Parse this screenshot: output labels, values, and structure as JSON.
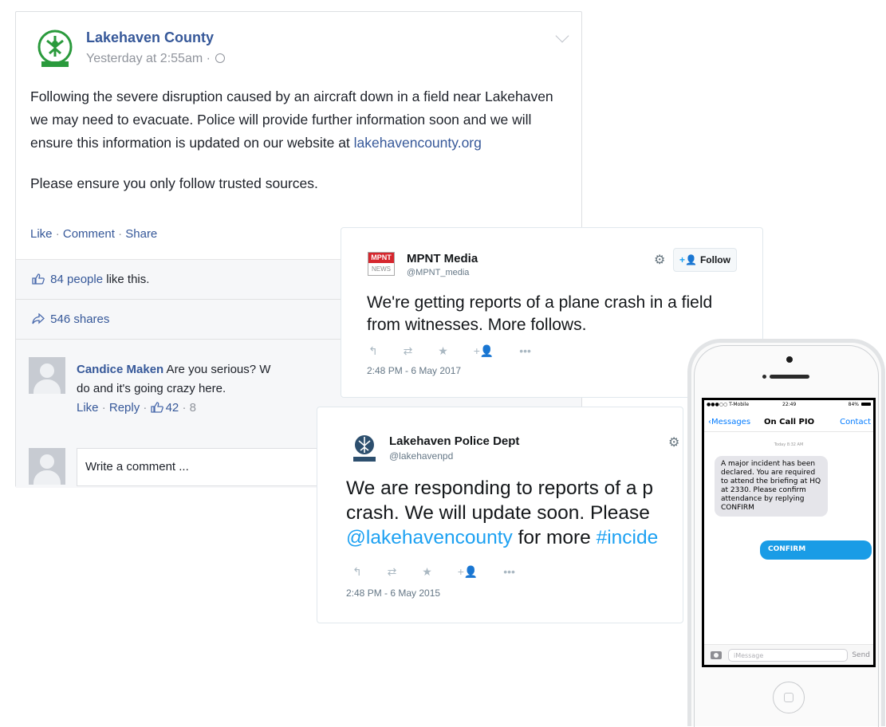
{
  "facebook": {
    "page_name": "Lakehaven County",
    "time": "Yesterday at 2:55am ·",
    "body_line1_pre": "Following the severe disruption caused by an aircraft down in a field near Lakehaven we may need to evacuate. Police will provide further information soon and we will ensure this information is updated on our website at ",
    "body_link": "lakehavencounty.org",
    "body_line2": "Please ensure you only follow trusted sources.",
    "actions": {
      "like": "Like",
      "comment": "Comment",
      "share": "Share",
      "separator": "·"
    },
    "likes_count": "84 people",
    "likes_suffix": " like this.",
    "shares": "546 shares",
    "comment": {
      "author": "Candice Maken",
      "text": " Are you serious? W",
      "text_line2": "do and it's going crazy here.",
      "like": "Like",
      "reply": "Reply",
      "likes": "42",
      "time": "8",
      "separator": "·"
    },
    "write_placeholder": "Write a comment ..."
  },
  "tweets": [
    {
      "name": "MPNT Media",
      "handle": "@MPNT_media",
      "logo_top": "MPNT",
      "logo_bottom": "NEWS",
      "follow_label": "Follow",
      "text": "We're getting reports of a plane crash in a field from witnesses. More follows.",
      "date": "2:48 PM - 6 May 2017"
    },
    {
      "name": "Lakehaven Police Dept",
      "handle": "@lakehavenpd",
      "text_line1": "We are responding to reports of a p",
      "text_line2": "crash. We will update soon. Please",
      "mention": "@lakehavencounty",
      "text_mid": " for more ",
      "hashtag": "#incide",
      "date": "2:48 PM - 6 May 2015"
    }
  ],
  "phone": {
    "carrier": "●●●○○ T-Mobile",
    "clock": "22:49",
    "battery": "84%",
    "back_label": "Messages",
    "title": "On Call PIO",
    "contact_label": "Contact",
    "date_label": "Today 8:32 AM",
    "incoming": "A major incident has been declared. You are required to attend the briefing at HQ at 2330. Please confirm attendance by replying CONFIRM",
    "outgoing": "CONFIRM",
    "input_placeholder": "iMessage",
    "send_label": "Send"
  },
  "colors": {
    "fb_link": "#365899",
    "twitter_blue": "#1da1f2",
    "imessage_blue": "#1a9ce6"
  }
}
